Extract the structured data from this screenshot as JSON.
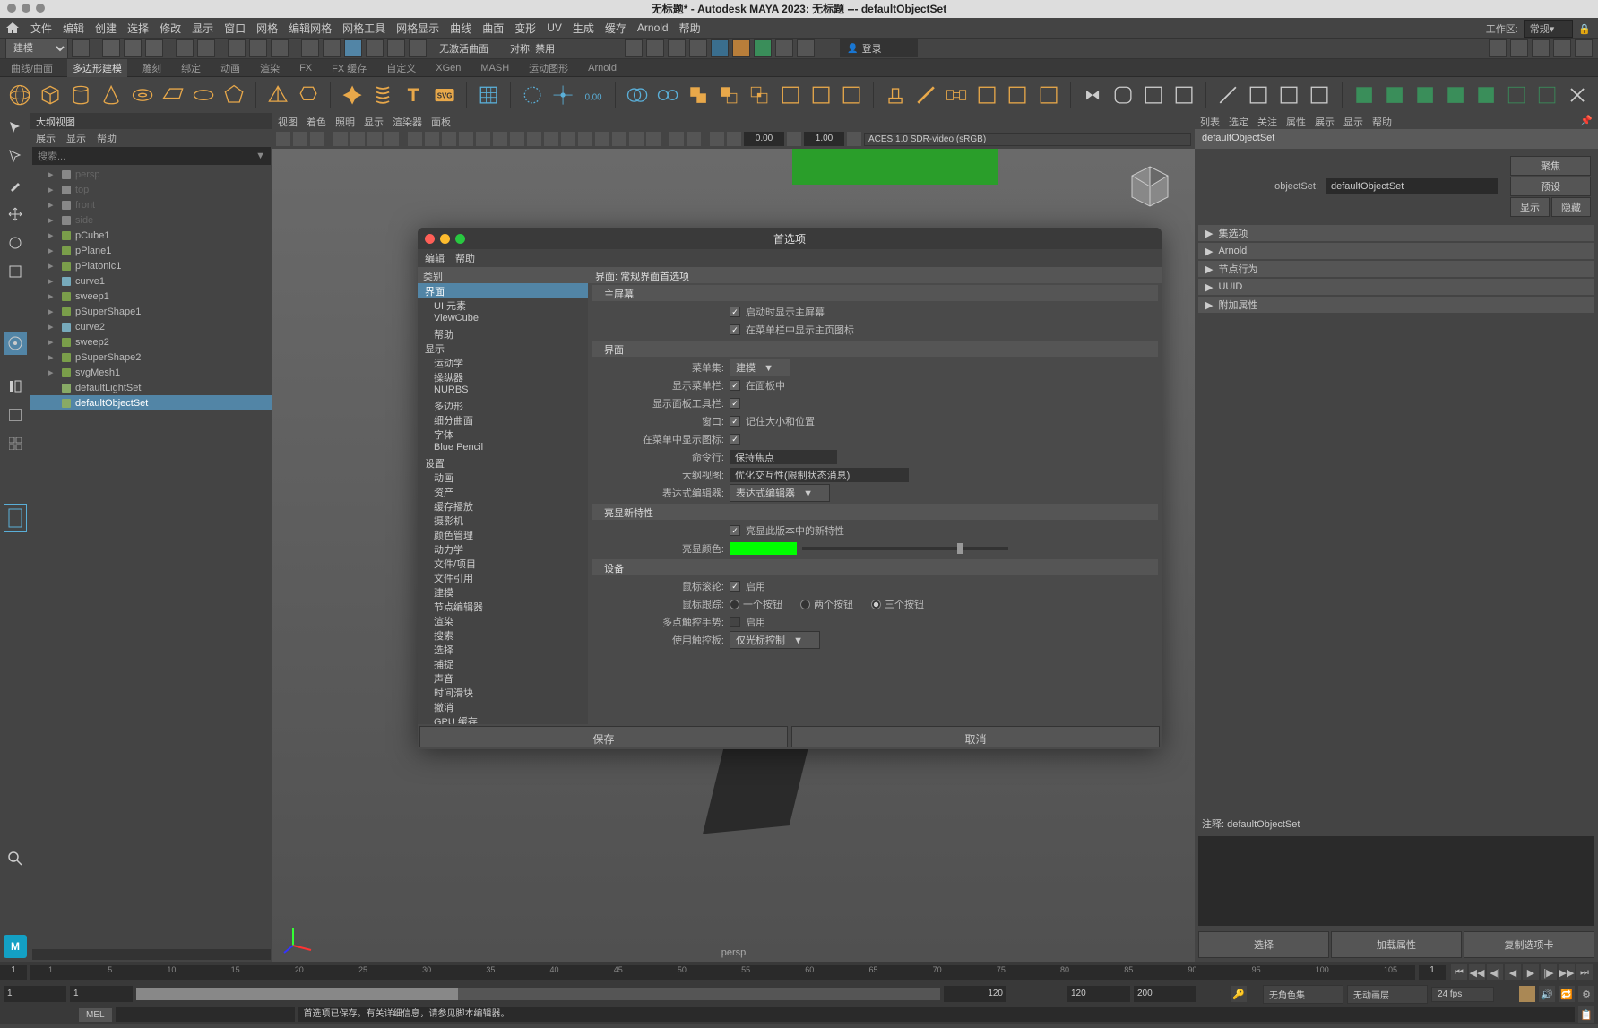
{
  "title": "无标题* - Autodesk MAYA 2023: 无标题  ---  defaultObjectSet",
  "menubar": [
    "文件",
    "编辑",
    "创建",
    "选择",
    "修改",
    "显示",
    "窗口",
    "网格",
    "编辑网格",
    "网格工具",
    "网格显示",
    "曲线",
    "曲面",
    "变形",
    "UV",
    "生成",
    "缓存",
    "Arnold",
    "帮助"
  ],
  "workspace": {
    "label": "工作区:",
    "value": "常规▾"
  },
  "statusline": {
    "mode": "建模",
    "snap_text1": "无激活曲面",
    "snap_text2": "对称: 禁用",
    "login": "登录"
  },
  "shelf_tabs": [
    "曲线/曲面",
    "多边形建模",
    "雕刻",
    "绑定",
    "动画",
    "渲染",
    "FX",
    "FX 缓存",
    "自定义",
    "XGen",
    "MASH",
    "运动图形",
    "Arnold"
  ],
  "shelf_active": "多边形建模",
  "outliner": {
    "title": "大纲视图",
    "menu": [
      "展示",
      "显示",
      "帮助"
    ],
    "search": "搜索...",
    "items": [
      {
        "name": "persp",
        "dim": true,
        "icon": "cam"
      },
      {
        "name": "top",
        "dim": true,
        "icon": "cam"
      },
      {
        "name": "front",
        "dim": true,
        "icon": "cam"
      },
      {
        "name": "side",
        "dim": true,
        "icon": "cam"
      },
      {
        "name": "pCube1",
        "icon": "mesh"
      },
      {
        "name": "pPlane1",
        "icon": "mesh"
      },
      {
        "name": "pPlatonic1",
        "icon": "mesh"
      },
      {
        "name": "curve1",
        "icon": "curve"
      },
      {
        "name": "sweep1",
        "icon": "mesh"
      },
      {
        "name": "pSuperShape1",
        "icon": "mesh"
      },
      {
        "name": "curve2",
        "icon": "curve"
      },
      {
        "name": "sweep2",
        "icon": "mesh"
      },
      {
        "name": "pSuperShape2",
        "icon": "mesh"
      },
      {
        "name": "svgMesh1",
        "icon": "mesh"
      },
      {
        "name": "defaultLightSet",
        "icon": "set"
      },
      {
        "name": "defaultObjectSet",
        "icon": "set",
        "selected": true
      }
    ]
  },
  "viewport": {
    "menu": [
      "视图",
      "着色",
      "照明",
      "显示",
      "渲染器",
      "面板"
    ],
    "field1": "0.00",
    "field2": "1.00",
    "colorspace": "ACES 1.0 SDR-video (sRGB)",
    "label": "persp"
  },
  "attr_editor": {
    "menu": [
      "列表",
      "选定",
      "关注",
      "属性",
      "展示",
      "显示",
      "帮助"
    ],
    "tab": "defaultObjectSet",
    "label": "objectSet:",
    "value": "defaultObjectSet",
    "btns": {
      "focus": "聚焦",
      "preset": "预设",
      "show": "显示",
      "hide": "隐藏"
    },
    "sections": [
      "集选项",
      "Arnold",
      "节点行为",
      "UUID",
      "附加属性"
    ],
    "notes_label": "注释: defaultObjectSet",
    "bottom": [
      "选择",
      "加载属性",
      "复制选项卡"
    ]
  },
  "timeline": {
    "current": "1",
    "marks": [
      "1",
      "5",
      "10",
      "15",
      "20",
      "25",
      "30",
      "35",
      "40",
      "45",
      "50",
      "55",
      "60",
      "65",
      "70",
      "75",
      "80",
      "85",
      "90",
      "95",
      "100",
      "105"
    ],
    "end": "1"
  },
  "range": {
    "start": "1",
    "end_min": "1",
    "end_max": "120",
    "range_start": "120",
    "range_end": "200",
    "color_mode": "无角色集",
    "layer": "无动画层",
    "fps": "24 fps"
  },
  "cmd": {
    "lang": "MEL",
    "output": "首选项已保存。有关详细信息，请参见脚本编辑器。"
  },
  "dialog": {
    "title": "首选项",
    "menu": [
      "编辑",
      "帮助"
    ],
    "cat_header": "类别",
    "categories": [
      {
        "name": "界面",
        "selected": true,
        "indent": false
      },
      {
        "name": "UI 元素",
        "indent": true
      },
      {
        "name": "ViewCube",
        "indent": true
      },
      {
        "name": "帮助",
        "indent": true
      },
      {
        "name": "显示",
        "indent": false
      },
      {
        "name": "运动学",
        "indent": true
      },
      {
        "name": "操纵器",
        "indent": true
      },
      {
        "name": "NURBS",
        "indent": true
      },
      {
        "name": "多边形",
        "indent": true
      },
      {
        "name": "细分曲面",
        "indent": true
      },
      {
        "name": "字体",
        "indent": true
      },
      {
        "name": "Blue Pencil",
        "indent": true
      },
      {
        "name": "设置",
        "indent": false
      },
      {
        "name": "动画",
        "indent": true
      },
      {
        "name": "资产",
        "indent": true
      },
      {
        "name": "缓存播放",
        "indent": true
      },
      {
        "name": "摄影机",
        "indent": true
      },
      {
        "name": "颜色管理",
        "indent": true
      },
      {
        "name": "动力学",
        "indent": true
      },
      {
        "name": "文件/项目",
        "indent": true
      },
      {
        "name": "文件引用",
        "indent": true
      },
      {
        "name": "建模",
        "indent": true
      },
      {
        "name": "节点编辑器",
        "indent": true
      },
      {
        "name": "渲染",
        "indent": true
      },
      {
        "name": "搜索",
        "indent": true
      },
      {
        "name": "选择",
        "indent": true
      },
      {
        "name": "捕捉",
        "indent": true
      },
      {
        "name": "声音",
        "indent": true
      },
      {
        "name": "时间滑块",
        "indent": true
      },
      {
        "name": "撤消",
        "indent": true
      },
      {
        "name": "GPU 缓存",
        "indent": true
      }
    ],
    "right_header": "界面: 常规界面首选项",
    "sec_main": "主屏幕",
    "row_startup": "启动时显示主屏幕",
    "row_menubar_icon": "在菜单栏中显示主页图标",
    "sec_interface": "界面",
    "row_menuset": {
      "label": "菜单集:",
      "value": "建模"
    },
    "row_show_menubar": {
      "label": "显示菜单栏:",
      "value": "在面板中"
    },
    "row_show_paneltool": {
      "label": "显示面板工具栏:"
    },
    "row_window": {
      "label": "窗口:",
      "value": "记住大小和位置"
    },
    "row_menu_icons": {
      "label": "在菜单中显示图标:"
    },
    "row_cmdline": {
      "label": "命令行:",
      "value": "保持焦点"
    },
    "row_outliner": {
      "label": "大纲视图:",
      "value": "优化交互性(限制状态消息)"
    },
    "row_expr": {
      "label": "表达式编辑器:",
      "value": "表达式编辑器"
    },
    "sec_highlight": "亮显新特性",
    "row_highlight_new": "亮显此版本中的新特性",
    "row_highlight_color": "亮显颜色:",
    "sec_device": "设备",
    "row_scroll": {
      "label": "鼠标滚轮:",
      "value": "启用"
    },
    "row_tracking": {
      "label": "鼠标跟踪:",
      "opts": [
        "一个按钮",
        "两个按钮",
        "三个按钮"
      ]
    },
    "row_multitouch": {
      "label": "多点触控手势:",
      "value": "启用"
    },
    "row_trackpad": {
      "label": "使用触控板:",
      "value": "仅光标控制"
    },
    "save": "保存",
    "cancel": "取消"
  }
}
